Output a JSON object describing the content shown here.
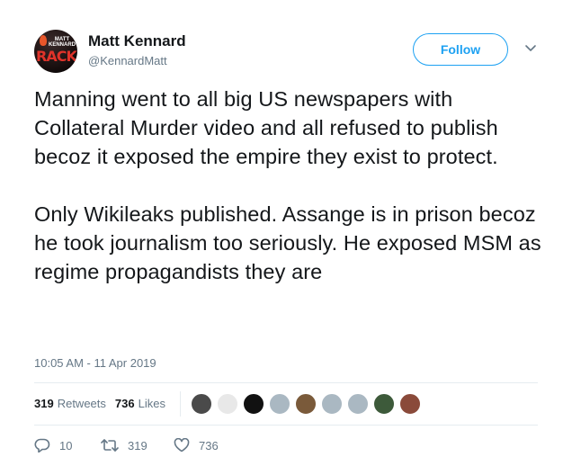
{
  "author": {
    "name": "Matt Kennard",
    "handle": "@KennardMatt",
    "avatar_text_top": "MATT\nKENNARD",
    "avatar_text_main": "RACKET"
  },
  "follow_label": "Follow",
  "tweet": {
    "text": "Manning went to all big US newspapers with Collateral Murder video and all refused to publish becoz it exposed the empire they exist to protect.\n\nOnly Wikileaks published. Assange is in prison becoz he took journalism too seriously. He exposed MSM as regime propagandists they are",
    "timestamp": "10:05 AM - 11 Apr 2019"
  },
  "stats": {
    "retweets_count": "319",
    "retweets_label": "Retweets",
    "likes_count": "736",
    "likes_label": "Likes"
  },
  "likers": [
    {
      "color": "#4a4a4a"
    },
    {
      "color": "#e8e8e8"
    },
    {
      "color": "#111111"
    },
    {
      "color": "#aab8c2"
    },
    {
      "color": "#7a5a3a"
    },
    {
      "color": "#aab8c2"
    },
    {
      "color": "#aab8c2"
    },
    {
      "color": "#3d5a3a"
    },
    {
      "color": "#8a4a3a"
    }
  ],
  "actions": {
    "reply_count": "10",
    "retweet_count": "319",
    "like_count": "736"
  },
  "colors": {
    "accent": "#1da1f2",
    "text": "#14171a",
    "muted": "#657786",
    "border": "#e6ecf0"
  }
}
